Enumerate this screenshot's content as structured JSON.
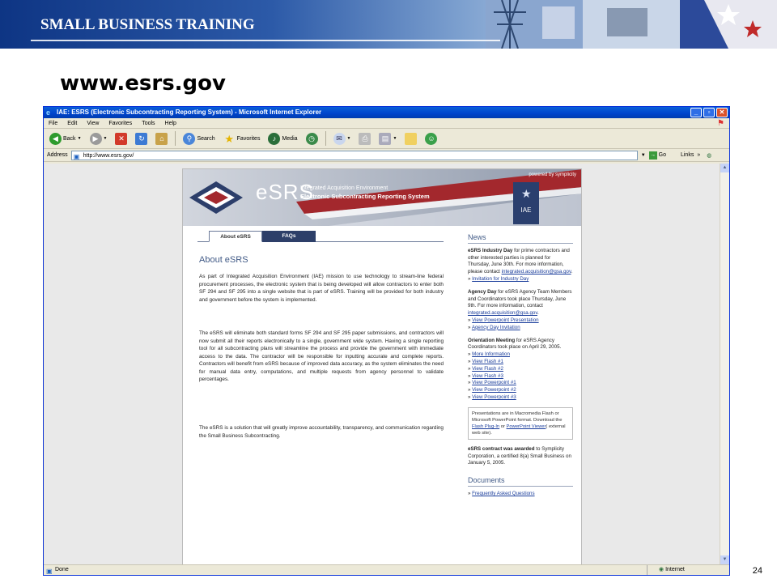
{
  "slide": {
    "banner_title": "SMALL BUSINESS TRAINING",
    "title": "www.esrs.gov",
    "page_number": "24"
  },
  "browser": {
    "window_title": "IAE: ESRS (Electronic Subcontracting Reporting System) - Microsoft Internet Explorer",
    "menu": [
      "File",
      "Edit",
      "View",
      "Favorites",
      "Tools",
      "Help"
    ],
    "toolbar": {
      "back": "Back",
      "search": "Search",
      "favorites": "Favorites",
      "media": "Media"
    },
    "address_label": "Address",
    "address_value": "http://www.esrs.gov/",
    "go_label": "Go",
    "links_label": "Links",
    "status_text": "Done",
    "zone_text": "Internet"
  },
  "site": {
    "powered_by": "powered by symplicity",
    "logo": "eSRS",
    "logo_sub1": "Integrated Acquisition Environment",
    "logo_sub2": "Electronic Subcontracting Reporting System",
    "badge": "IAE",
    "tabs": [
      "About eSRS",
      "FAQs"
    ],
    "heading": "About eSRS",
    "paragraphs": [
      "As part of Integrated Acquisition Environment (IAE) mission to use technology to stream-line federal procurement processes, the electronic system that is being developed will allow contractors to enter both SF 294 and SF 295 into a single website that is part of eSRS. Training will be provided for both industry and government before the system is implemented.",
      "The eSRS will eliminate both standard forms SF 294 and SF 295 paper submissions, and contractors will now submit all their reports electronically to a single, government wide system. Having a single reporting tool for all subcontracting plans will streamline the process and provide the government with immediate access to the data. The contractor will be responsible for inputting accurate and complete reports. Contractors will benefit from eSRS because of improved data accuracy, as the system eliminates the need for manual data entry, computations, and multiple requests from agency personnel to validate percentages.",
      "The eSRS is a solution that will greatly improve accountability, transparency, and communication regarding the Small Business Subcontracting."
    ],
    "news_heading": "News",
    "news1_title": "eSRS Industry Day",
    "news1_text": " for prime contractors and other interested parties is planned for Thursday, June 30th. For more information, please contact ",
    "news1_email": "integrated.acquisition@gsa.gov",
    "news1_link": "Invitation for Industry Day",
    "news2_title": "Agency Day",
    "news2_text": " for eSRS Agency Team Members and Coordinators took place Thursday, June 9th. For more information, contact ",
    "news2_email": "integrated.acquisition@gsa.gov",
    "news2_links": [
      "View Powerpoint Presentation",
      "Agency Day Invitation"
    ],
    "news3_title": "Orientation Meeting",
    "news3_text": " for eSRS Agency Coordinators took place on April 29, 2005.",
    "news3_links": [
      "More Information",
      "View Flash #1",
      "View Flash #2",
      "View Flash #3",
      "View Powerpoint #1",
      "View Powerpoint #2",
      "View Powerpoint #3"
    ],
    "box_text1": "Presentations are in Macromedia Flash or Microsoft PowerPoint format. Download the ",
    "box_link1": "Flash Plug-In",
    "box_text2": " or ",
    "box_link2": "PowerPoint Viewer",
    "box_text3": "( external web site).",
    "news4_title": "eSRS contract was awarded",
    "news4_text": " to Symplicity Corporation, a certified 8(a) Small Business on January 5, 2005.",
    "docs_heading": "Documents",
    "docs_link": "Frequently Asked Questions"
  }
}
